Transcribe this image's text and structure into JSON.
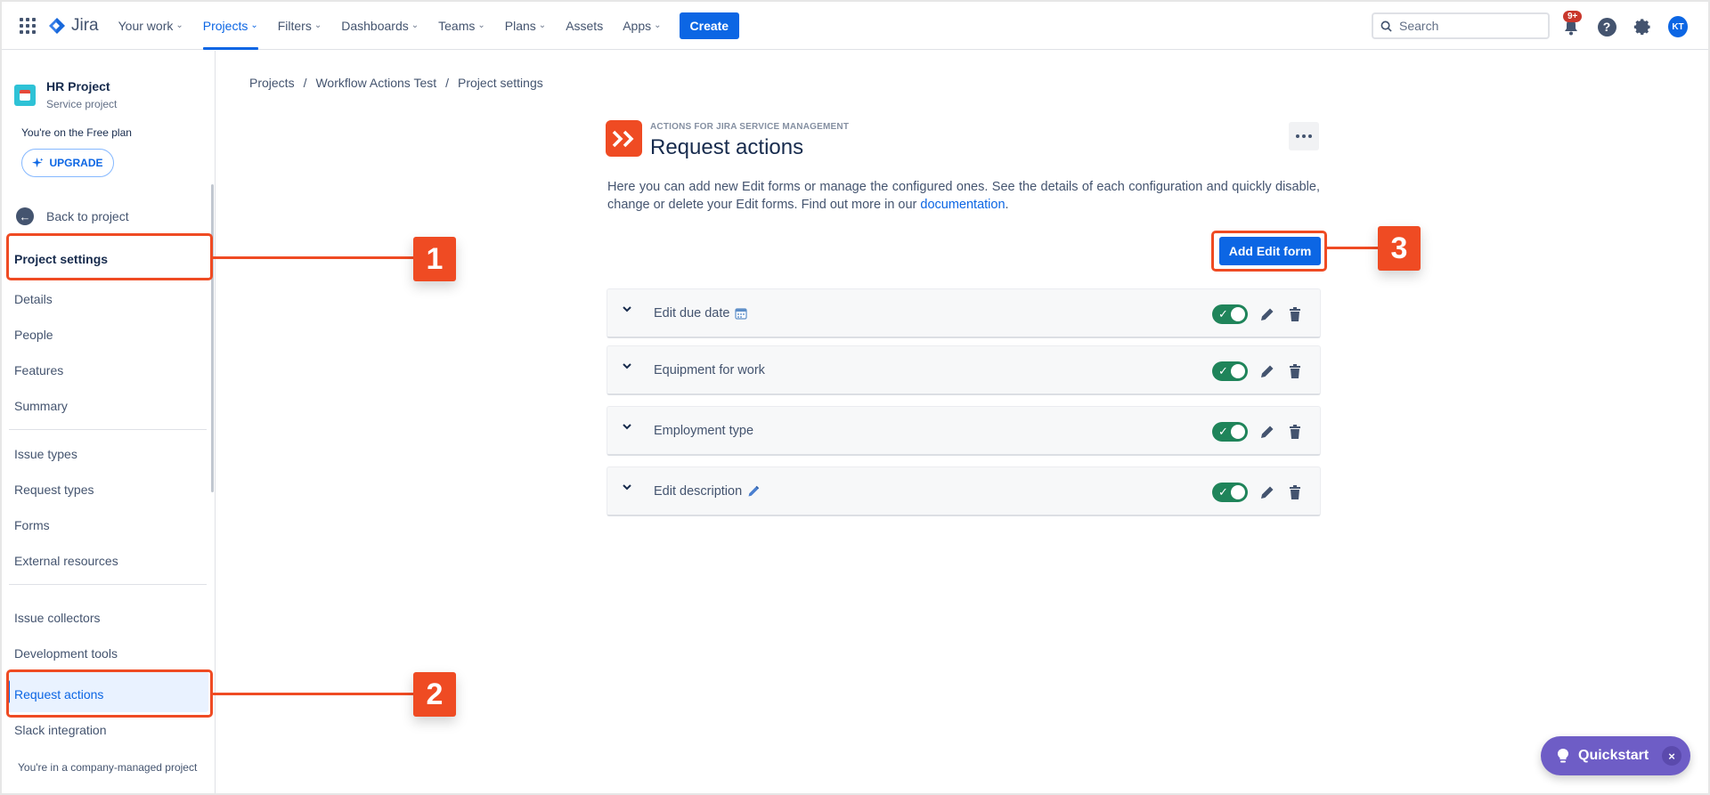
{
  "nav": {
    "logo": "Jira",
    "items": [
      {
        "label": "Your work",
        "chevron": true
      },
      {
        "label": "Projects",
        "chevron": true,
        "active": true
      },
      {
        "label": "Filters",
        "chevron": true
      },
      {
        "label": "Dashboards",
        "chevron": true
      },
      {
        "label": "Teams",
        "chevron": true
      },
      {
        "label": "Plans",
        "chevron": true
      },
      {
        "label": "Assets",
        "chevron": false
      },
      {
        "label": "Apps",
        "chevron": true
      }
    ],
    "create_label": "Create",
    "search_placeholder": "Search",
    "notifications_badge": "9+",
    "help_glyph": "?",
    "avatar_initials": "KT"
  },
  "sidebar": {
    "project_name": "HR Project",
    "project_type": "Service project",
    "plan_text": "You're on the Free plan",
    "upgrade_label": "UPGRADE",
    "back_label": "Back to project",
    "heading": "Project settings",
    "group1": [
      "Details",
      "People",
      "Features",
      "Summary"
    ],
    "group2": [
      "Issue types",
      "Request types",
      "Forms",
      "External resources"
    ],
    "group3": [
      "Issue collectors",
      "Development tools",
      "Request actions",
      "Slack integration"
    ],
    "selected_item": "Request actions",
    "footer": "You're in a company-managed project"
  },
  "main": {
    "breadcrumb": [
      "Projects",
      "Workflow Actions Test",
      "Project settings"
    ],
    "breadcrumb_sep": "/",
    "app_eyebrow": "ACTIONS FOR JIRA SERVICE MANAGEMENT",
    "title": "Request actions",
    "description_pre": "Here you can add new Edit forms or manage the configured ones. See the details of each configuration and quickly disable, change or delete your Edit forms. Find out more in our ",
    "description_link": "documentation",
    "description_post": ".",
    "add_button": "Add Edit form",
    "forms": [
      {
        "title": "Edit due date",
        "icon": "calendar-icon",
        "enabled": true
      },
      {
        "title": "Equipment for work",
        "icon": "",
        "enabled": true
      },
      {
        "title": "Employment type",
        "icon": "",
        "enabled": true
      },
      {
        "title": "Edit description",
        "icon": "pencil-icon",
        "enabled": true
      }
    ]
  },
  "annotations": [
    "1",
    "2",
    "3"
  ],
  "quickstart": {
    "label": "Quickstart",
    "close": "×"
  },
  "colors": {
    "accent": "#0c66e4",
    "annotation": "#ef4b23",
    "toggle_on": "#1f845a",
    "quickstart": "#6e5dc6"
  }
}
